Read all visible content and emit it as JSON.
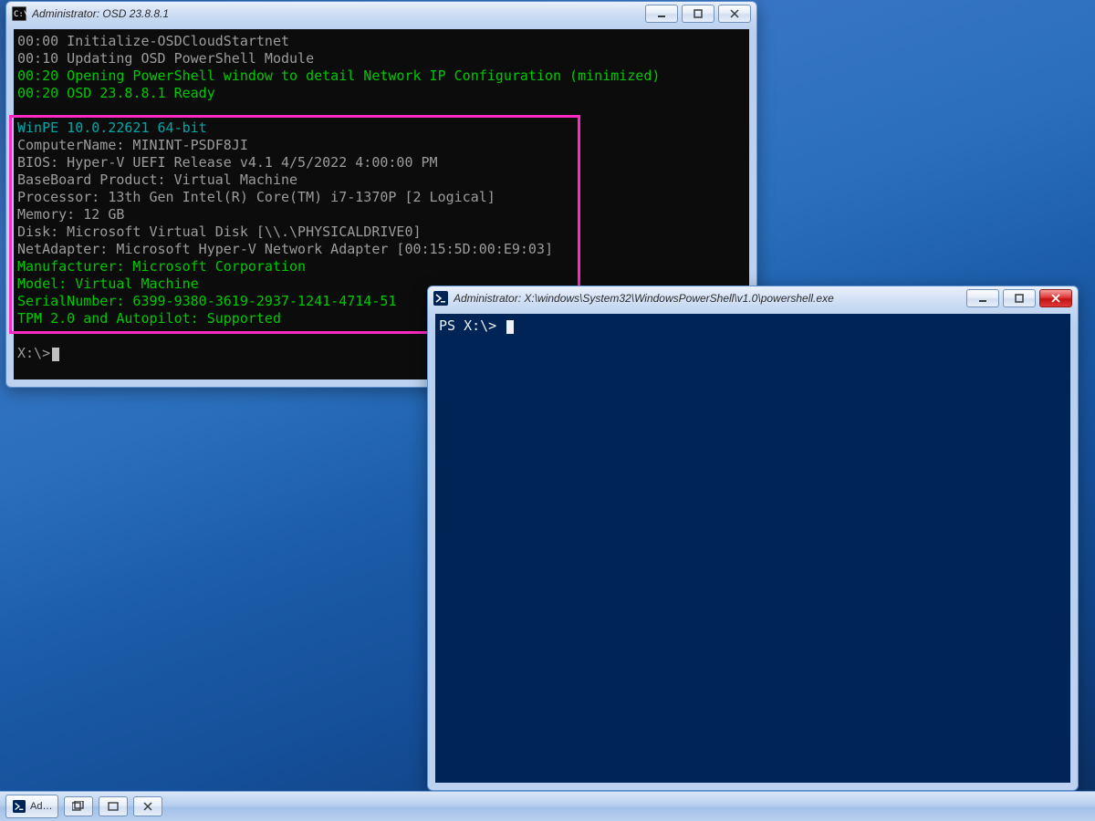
{
  "cmd_window": {
    "title": "Administrator:  OSD 23.8.8.1",
    "lines": [
      {
        "c": "gray",
        "t": "00:00 Initialize-OSDCloudStartnet"
      },
      {
        "c": "gray",
        "t": "00:10 Updating OSD PowerShell Module"
      },
      {
        "c": "green",
        "t": "00:20 Opening PowerShell window to detail Network IP Configuration (minimized)"
      },
      {
        "c": "green",
        "t": "00:20 OSD 23.8.8.1 Ready"
      },
      {
        "c": "gray",
        "t": ""
      },
      {
        "c": "cyan",
        "t": "WinPE 10.0.22621 64-bit"
      },
      {
        "c": "gray",
        "t": "ComputerName: MININT-PSDF8JI"
      },
      {
        "c": "gray",
        "t": "BIOS: Hyper-V UEFI Release v4.1 4/5/2022 4:00:00 PM"
      },
      {
        "c": "gray",
        "t": "BaseBoard Product: Virtual Machine"
      },
      {
        "c": "gray",
        "t": "Processor: 13th Gen Intel(R) Core(TM) i7-1370P [2 Logical]"
      },
      {
        "c": "gray",
        "t": "Memory: 12 GB"
      },
      {
        "c": "gray",
        "t": "Disk: Microsoft Virtual Disk [\\\\.\\PHYSICALDRIVE0]"
      },
      {
        "c": "gray",
        "t": "NetAdapter: Microsoft Hyper-V Network Adapter [00:15:5D:00:E9:03]"
      },
      {
        "c": "green",
        "t": "Manufacturer: Microsoft Corporation"
      },
      {
        "c": "green",
        "t": "Model: Virtual Machine"
      },
      {
        "c": "green",
        "t": "SerialNumber: 6399-9380-3619-2937-1241-4714-51"
      },
      {
        "c": "green",
        "t": "TPM 2.0 and Autopilot: Supported"
      }
    ],
    "prompt": "X:\\>"
  },
  "ps_window": {
    "title": "Administrator: X:\\windows\\System32\\WindowsPowerShell\\v1.0\\powershell.exe",
    "prompt": "PS X:\\> "
  },
  "taskbar": {
    "task_label": "Ad…"
  }
}
